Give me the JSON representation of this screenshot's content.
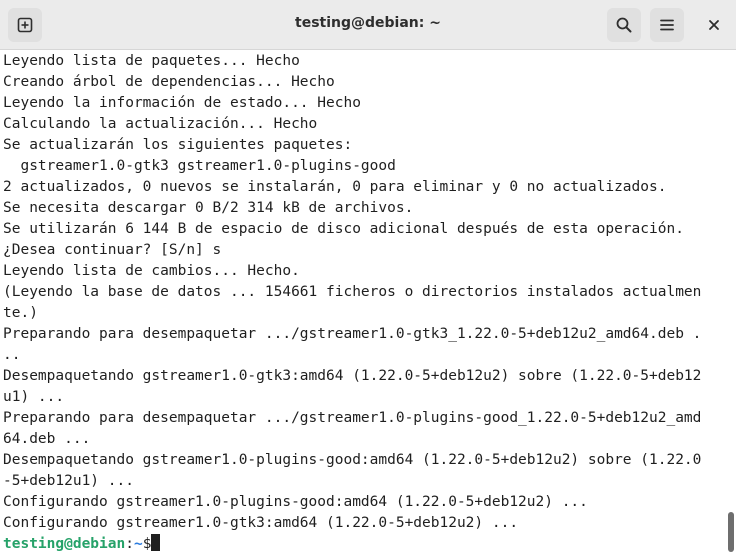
{
  "window": {
    "title": "testing@debian: ~"
  },
  "header": {
    "icons": [
      "new-tab-icon",
      "search-icon",
      "hamburger-menu-icon",
      "close-icon"
    ]
  },
  "terminal": {
    "lines": [
      "Leyendo lista de paquetes... Hecho",
      "Creando árbol de dependencias... Hecho",
      "Leyendo la información de estado... Hecho",
      "Calculando la actualización... Hecho",
      "Se actualizarán los siguientes paquetes:",
      "  gstreamer1.0-gtk3 gstreamer1.0-plugins-good",
      "2 actualizados, 0 nuevos se instalarán, 0 para eliminar y 0 no actualizados.",
      "Se necesita descargar 0 B/2 314 kB de archivos.",
      "Se utilizarán 6 144 B de espacio de disco adicional después de esta operación.",
      "¿Desea continuar? [S/n] s",
      "Leyendo lista de cambios... Hecho.",
      "(Leyendo la base de datos ... 154661 ficheros o directorios instalados actualmen",
      "te.)",
      "Preparando para desempaquetar .../gstreamer1.0-gtk3_1.22.0-5+deb12u2_amd64.deb .",
      "..",
      "Desempaquetando gstreamer1.0-gtk3:amd64 (1.22.0-5+deb12u2) sobre (1.22.0-5+deb12",
      "u1) ...",
      "Preparando para desempaquetar .../gstreamer1.0-plugins-good_1.22.0-5+deb12u2_amd",
      "64.deb ...",
      "Desempaquetando gstreamer1.0-plugins-good:amd64 (1.22.0-5+deb12u2) sobre (1.22.0",
      "-5+deb12u1) ...",
      "Configurando gstreamer1.0-plugins-good:amd64 (1.22.0-5+deb12u2) ...",
      "Configurando gstreamer1.0-gtk3:amd64 (1.22.0-5+deb12u2) ..."
    ],
    "prompt": {
      "user_host": "testing@debian",
      "colon": ":",
      "path": "~",
      "symbol": "$"
    }
  },
  "colors": {
    "prompt_user": "#26a269",
    "prompt_path": "#2a7bde",
    "text": "#1f1f1f",
    "header_bg": "#ebebeb"
  }
}
